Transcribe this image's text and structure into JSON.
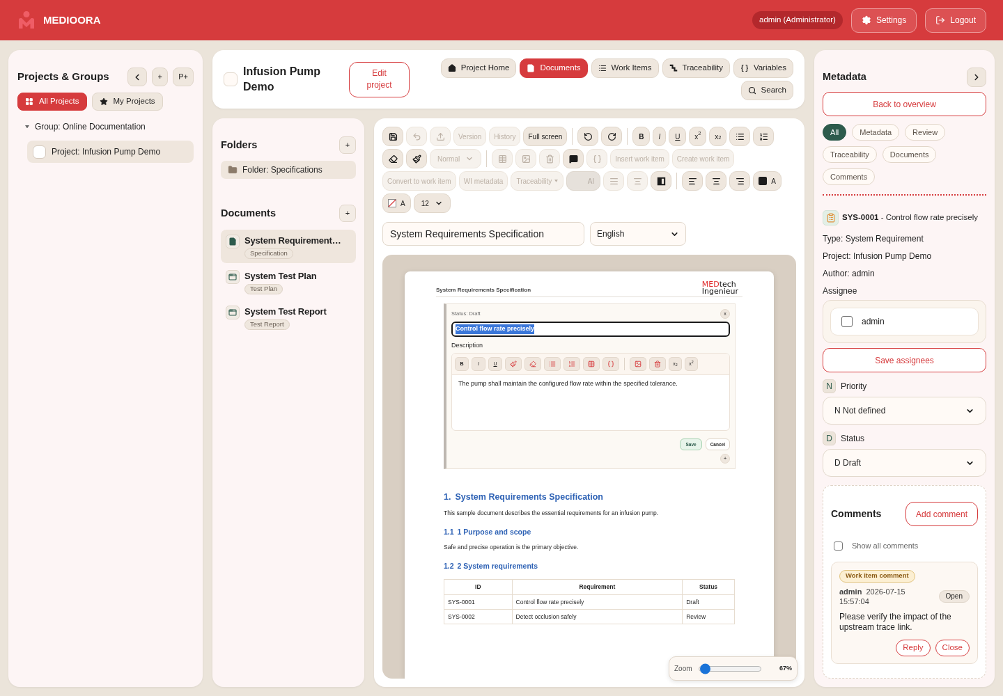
{
  "header": {
    "brand": "MEDIOORA",
    "user": "admin (Administrator)",
    "buttons": [
      "Settings",
      "Logout"
    ]
  },
  "projects_panel": {
    "title": "Projects & Groups",
    "tools": [
      {
        "kind": "icon"
      },
      {
        "kind": "text",
        "label": "+"
      },
      {
        "kind": "text",
        "label": "P+"
      }
    ],
    "filters": [
      {
        "label": "All Projects",
        "selected": true
      },
      {
        "label": "My Projects",
        "selected": false
      }
    ],
    "groups": [
      {
        "label": "Group: Online Documentation",
        "expanded": true,
        "children": [
          {
            "label": "Project: Infusion Pump Demo",
            "checked": false,
            "selected": true
          }
        ]
      }
    ]
  },
  "project": {
    "checked": false,
    "title": "Infusion Pump Demo",
    "edit_button": "Edit project",
    "nav": [
      {
        "label": "Project Home",
        "selected": false
      },
      {
        "label": "Documents",
        "selected": true
      },
      {
        "label": "Work Items",
        "selected": false
      },
      {
        "label": "Traceability",
        "selected": false
      },
      {
        "label": "Variables",
        "selected": false
      },
      {
        "label": "Search",
        "selected": false
      }
    ]
  },
  "folders": {
    "title": "Folders",
    "add": "+",
    "items": [
      {
        "label": "Folder: Specifications"
      }
    ]
  },
  "documents": {
    "title": "Documents",
    "add": "+",
    "items": [
      {
        "kind": "specification",
        "title": "System Requirement…",
        "tag": "Specification",
        "selected": true
      },
      {
        "kind": "test_plan",
        "title": "System Test Plan",
        "tag": "Test Plan",
        "selected": false
      },
      {
        "kind": "test_report",
        "title": "System Test Report",
        "tag": "Test Report",
        "selected": false
      }
    ]
  },
  "editor": {
    "toolbar": [
      [
        {
          "kind": "icon",
          "disabled": false
        },
        {
          "kind": "icon",
          "disabled": true
        },
        {
          "kind": "icon",
          "disabled": true
        },
        {
          "kind": "text",
          "label": "Version",
          "disabled": true
        },
        {
          "kind": "text",
          "label": "History",
          "disabled": true
        },
        {
          "kind": "text",
          "label": "Full screen",
          "disabled": false
        },
        {
          "kind": "separator"
        },
        {
          "kind": "icon",
          "disabled": false
        },
        {
          "kind": "icon",
          "disabled": false
        },
        {
          "kind": "separator"
        },
        {
          "kind": "bold",
          "label": "B",
          "disabled": false
        },
        {
          "kind": "italic",
          "label": "I",
          "disabled": false
        },
        {
          "kind": "underline",
          "label": "U",
          "disabled": false
        },
        {
          "kind": "rich",
          "label": "x$^{2}$",
          "disabled": false
        },
        {
          "kind": "rich",
          "label": "x$_{2}$",
          "disabled": false
        },
        {
          "kind": "icon",
          "disabled": false
        },
        {
          "kind": "icon",
          "disabled": false
        }
      ],
      [
        {
          "kind": "icon",
          "disabled": false
        },
        {
          "kind": "icon",
          "disabled": false
        },
        {
          "kind": "select",
          "label": "Normal",
          "disabled": true
        },
        {
          "kind": "separator"
        },
        {
          "kind": "icon",
          "disabled": true
        },
        {
          "kind": "icon",
          "disabled": true
        },
        {
          "kind": "icon",
          "disabled": true
        },
        {
          "kind": "icon",
          "disabled": false
        },
        {
          "kind": "icon",
          "disabled": true
        },
        {
          "kind": "text",
          "label": "Insert work item",
          "disabled": true
        },
        {
          "kind": "text",
          "label": "Create work item",
          "disabled": true
        }
      ],
      [
        {
          "kind": "text",
          "label": "Convert to work item",
          "disabled": true
        },
        {
          "kind": "text",
          "label": "WI metadata",
          "disabled": true
        },
        {
          "kind": "dropdown",
          "label": "Traceability",
          "disabled": true
        },
        {
          "kind": "filled",
          "label": "AI",
          "disabled": true
        },
        {
          "kind": "icon",
          "disabled": true
        },
        {
          "kind": "icon",
          "disabled": true
        },
        {
          "kind": "icon",
          "disabled": false
        },
        {
          "kind": "separator"
        },
        {
          "kind": "icon",
          "disabled": false
        },
        {
          "kind": "icon",
          "disabled": false
        },
        {
          "kind": "icon",
          "disabled": false
        },
        {
          "kind": "swatch",
          "label": "A",
          "color": "#1c1c1c",
          "disabled": false
        }
      ],
      [
        {
          "kind": "no_fill",
          "label": "A",
          "disabled": false
        },
        {
          "kind": "select",
          "label": "12",
          "disabled": false
        }
      ]
    ],
    "title_field": "System Requirements Specification",
    "language": "English",
    "page": {
      "running_title": "System Requirements Specification",
      "logo": {
        "accent": "MED",
        "rest": "tech",
        "second_line": "Ingenieur"
      },
      "work_item": {
        "status": "Status: Draft",
        "close": "x",
        "title": "Control flow rate precisely",
        "title_selected": true,
        "description_label": "Description",
        "toolbar": [
          {
            "kind": "bold",
            "label": "B"
          },
          {
            "kind": "italic",
            "label": "I"
          },
          {
            "kind": "underline",
            "label": "U"
          },
          {
            "kind": "icon"
          },
          {
            "kind": "icon"
          },
          {
            "kind": "icon"
          },
          {
            "kind": "icon"
          },
          {
            "kind": "icon"
          },
          {
            "kind": "icon"
          },
          {
            "kind": "separator"
          },
          {
            "kind": "icon"
          },
          {
            "kind": "icon"
          },
          {
            "kind": "rich",
            "label": "x$_{2}$"
          },
          {
            "kind": "rich",
            "label": "x$^{2}$"
          }
        ],
        "body": "The pump shall maintain the configured flow rate within the specified tolerance.",
        "buttons": [
          {
            "kind": "primary",
            "label": "Save"
          },
          {
            "kind": "secondary",
            "label": "Cancel"
          }
        ],
        "add": "+"
      },
      "content": [
        {
          "kind": "heading_1",
          "number": "1.",
          "text": "System Requirements Specification"
        },
        {
          "kind": "paragraph",
          "text": "This sample document describes the essential requirements for an infusion pump."
        },
        {
          "kind": "heading_2",
          "number": "1.1",
          "text": "1 Purpose and scope"
        },
        {
          "kind": "paragraph",
          "text": "Safe and precise operation is the primary objective."
        },
        {
          "kind": "heading_2",
          "number": "1.2",
          "text": "2 System requirements"
        },
        {
          "kind": "table",
          "columns": [
            "ID",
            "Requirement",
            "Status"
          ],
          "rows": [
            [
              "SYS-0001",
              "Control flow rate precisely",
              "Draft"
            ],
            [
              "SYS-0002",
              "Detect occlusion safely",
              "Review"
            ]
          ]
        }
      ]
    },
    "zoom": {
      "label": "Zoom",
      "level": 0.02,
      "reading": "67%"
    }
  },
  "metadata": {
    "title": "Metadata",
    "back": "Back to overview",
    "filters": [
      {
        "label": "All",
        "selected": true
      },
      {
        "label": "Metadata",
        "selected": false
      },
      {
        "label": "Review",
        "selected": false
      },
      {
        "label": "Traceability",
        "selected": false
      },
      {
        "label": "Documents",
        "selected": false
      },
      {
        "label": "Comments",
        "selected": false
      }
    ],
    "item_heading": "**SYS-0001** - Control flow rate precisely",
    "fields": [
      "Type: System Requirement",
      "Project: Infusion Pump Demo",
      "Author: admin"
    ],
    "assignee": {
      "label": "Assignee",
      "options": [
        {
          "label": "admin",
          "checked": false
        }
      ],
      "save": "Save assignees"
    },
    "selects": [
      {
        "badge": "N",
        "label": "Priority",
        "value": "N Not defined"
      },
      {
        "badge": "D",
        "label": "Status",
        "value": "D Draft"
      }
    ],
    "comments": {
      "title": "Comments",
      "add": "Add comment",
      "show_all": {
        "label": "Show all comments",
        "checked": false
      },
      "items": [
        {
          "tag": "Work item comment",
          "author": "admin",
          "time": "2026-07-15 15:57:04",
          "state": "Open",
          "text": "Please verify the impact of the upstream trace link.",
          "actions": [
            "Reply",
            "Close"
          ]
        }
      ]
    }
  }
}
